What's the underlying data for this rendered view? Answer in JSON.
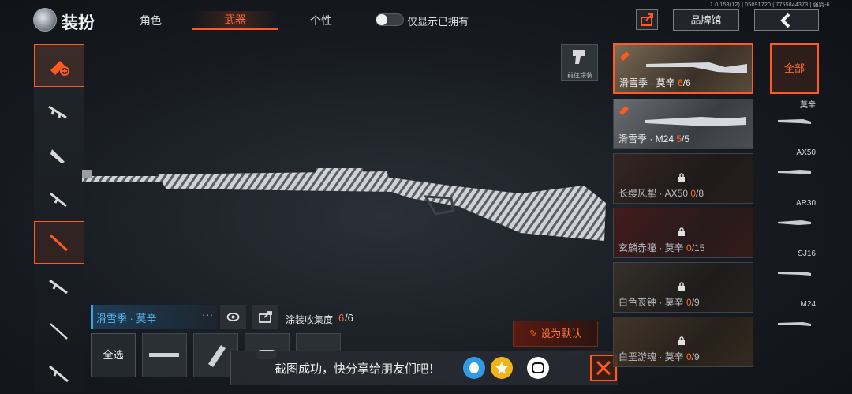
{
  "header": {
    "title": "装扮",
    "tabs": [
      {
        "label": "角色"
      },
      {
        "label": "武器"
      },
      {
        "label": "个性"
      }
    ],
    "toggle_label": "仅显示已拥有",
    "version": "1.0.158(12) | 05091720 | 7755844373 | 强箭-6",
    "brand_button": "品牌馆",
    "back_icon": "chevron-left-icon"
  },
  "sidebar": {
    "items": [
      {
        "icon": "spray-skin-icon"
      },
      {
        "icon": "assault-rifle-icon"
      },
      {
        "icon": "smg-icon"
      },
      {
        "icon": "shotgun-icon"
      },
      {
        "icon": "sniper-rifle-icon"
      },
      {
        "icon": "rifle-icon"
      },
      {
        "icon": "marksman-rifle-icon"
      },
      {
        "icon": "dmr-icon"
      }
    ]
  },
  "center": {
    "goto_paint_label": "前往涂装",
    "skin_name": "滑雪季 · 莫辛",
    "more_dots": "···",
    "collection_label": "涂装收集度",
    "collection_owned": "6",
    "collection_total": "/6",
    "select_all": "全选",
    "set_default": "设为默认"
  },
  "toast": {
    "text": "截图成功，快分享给朋友们吧！"
  },
  "skins": [
    {
      "name": "滑雪季 · 莫辛 ",
      "owned": "6",
      "total": "/6",
      "locked": false,
      "active": true
    },
    {
      "name": "滑雪季 · M24 ",
      "owned": "5",
      "total": "/5",
      "locked": false,
      "active": false
    },
    {
      "name": "长缨风掣 · AX50 ",
      "owned": "0",
      "total": "/8",
      "locked": true,
      "active": false
    },
    {
      "name": "玄麟赤瞳 · 莫辛 ",
      "owned": "0",
      "total": "/15",
      "locked": true,
      "active": false
    },
    {
      "name": "白色丧钟 · 莫辛 ",
      "owned": "0",
      "total": "/9",
      "locked": true,
      "active": false
    },
    {
      "name": "白垩游魂 · 莫辛 ",
      "owned": "0",
      "total": "/9",
      "locked": true,
      "active": false
    }
  ],
  "filters": {
    "all_label": "全部",
    "items": [
      {
        "label": "莫辛"
      },
      {
        "label": "AX50"
      },
      {
        "label": "AR30"
      },
      {
        "label": "SJ16"
      },
      {
        "label": "M24"
      }
    ]
  },
  "colors": {
    "accent": "#ff5a1f",
    "highlight_blue": "#58b8f0"
  }
}
